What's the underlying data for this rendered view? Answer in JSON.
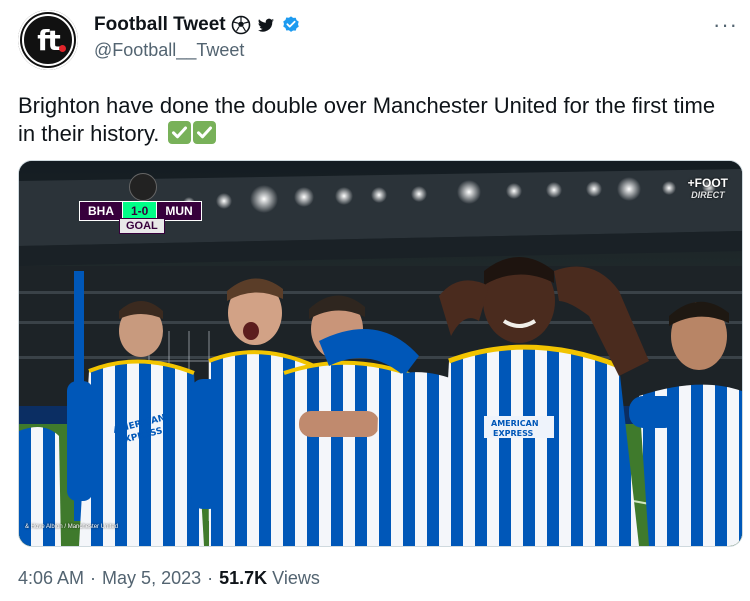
{
  "account": {
    "avatar_text": "ft",
    "display_name": "Football Tweet",
    "handle": "@Football__Tweet",
    "badges": [
      "soccer-ball-icon",
      "bird-icon",
      "verified-badge-icon"
    ],
    "verified_color": "#1d9bf0"
  },
  "menu": {
    "more_label": "···"
  },
  "tweet": {
    "text": "Brighton have done the double over Manchester United for the first time in their history. ",
    "emojis": [
      "check-mark-icon",
      "check-mark-icon"
    ]
  },
  "media": {
    "scorebug": {
      "home": "BHA",
      "score": "1-0",
      "away": "MUN",
      "status": "GOAL"
    },
    "broadcaster": {
      "line1": "+FOOT",
      "line2": "DIRECT"
    },
    "caption": "& Hove Albion / Manchester United",
    "jersey_sponsor": "AMERICAN EXPRESS"
  },
  "meta": {
    "time": "4:06 AM",
    "date": "May 5, 2023",
    "views_count": "51.7K",
    "views_label": "Views"
  },
  "colors": {
    "text_primary": "#0f1419",
    "text_secondary": "#536471",
    "brighton_blue": "#0057b8",
    "premier_league_purple": "#37003c",
    "premier_league_green": "#00ff87",
    "check_green": "#78b159"
  }
}
